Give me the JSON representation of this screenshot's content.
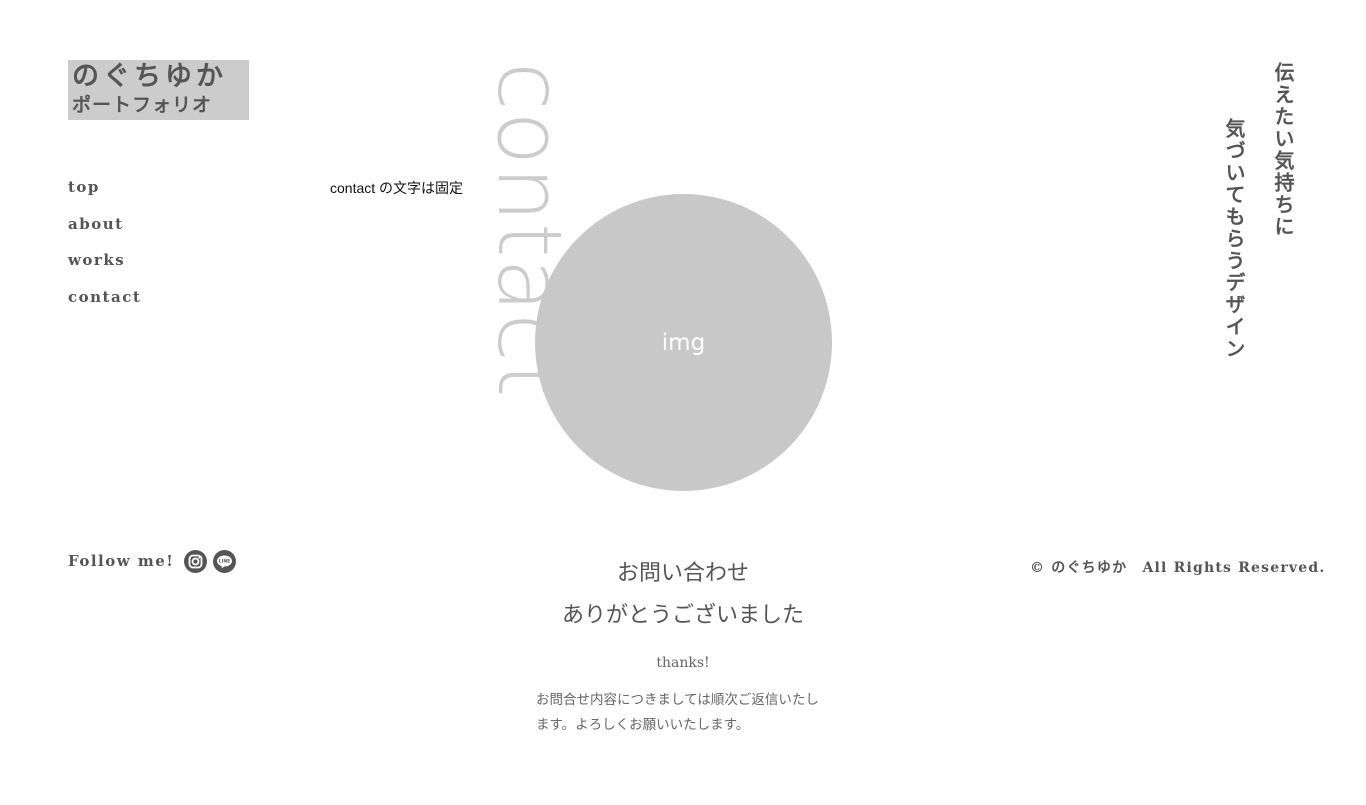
{
  "header": {
    "logo_line1": "のぐちゆか",
    "logo_line2": "ポートフォリオ"
  },
  "nav": {
    "items": [
      {
        "label": "top"
      },
      {
        "label": "about"
      },
      {
        "label": "works"
      },
      {
        "label": "contact"
      }
    ]
  },
  "main": {
    "fixed_note": "contact の文字は固定",
    "big_word": "contact",
    "image_placeholder": "img"
  },
  "tagline": {
    "line1": "伝えたい気持ちに",
    "line2": "気づいてもらうデザイン"
  },
  "thanks": {
    "title_line1": "お問い合わせ",
    "title_line2": "ありがとうございました",
    "subtitle": "thanks!",
    "body": "お問合せ内容につきましては順次ご返信いたします。よろしくお願いいたします。"
  },
  "footer": {
    "follow_label": "Follow me!",
    "social": [
      {
        "icon": "instagram-icon"
      },
      {
        "icon": "line-icon",
        "text": "LINE"
      }
    ],
    "copyright": "© のぐちゆか　All Rights Reserved."
  },
  "colors": {
    "text": "#555555",
    "logo_bg": "#cccccc",
    "circle": "#c8c8c8",
    "big_word": "#cccccc"
  }
}
